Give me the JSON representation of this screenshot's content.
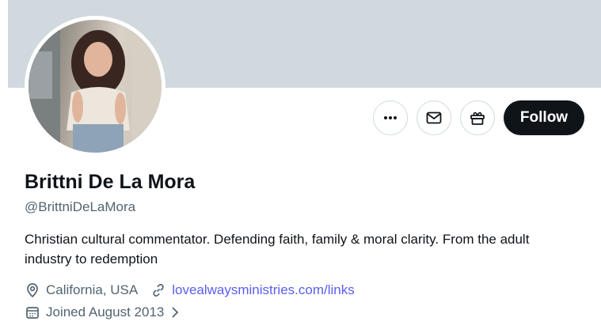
{
  "profile": {
    "name": "Brittni De La Mora",
    "handle": "@BrittniDeLaMora",
    "bio": "Christian cultural commentator. Defending faith, family & moral clarity. From the adult industry to redemption",
    "location": "California, USA",
    "website": "lovealwaysministries.com/links",
    "joined": "Joined August 2013"
  },
  "actions": {
    "follow_label": "Follow"
  },
  "icons": {
    "more": "more-dots-icon",
    "message": "mail-icon",
    "subscribe": "gift-icon",
    "location": "location-pin-icon",
    "link": "link-icon",
    "calendar": "calendar-icon",
    "chevron": "chevron-right-icon"
  },
  "colors": {
    "banner": "#cfd9de",
    "follow_bg": "#0f1419",
    "link": "#5a5ef0",
    "secondary_text": "#536471"
  }
}
